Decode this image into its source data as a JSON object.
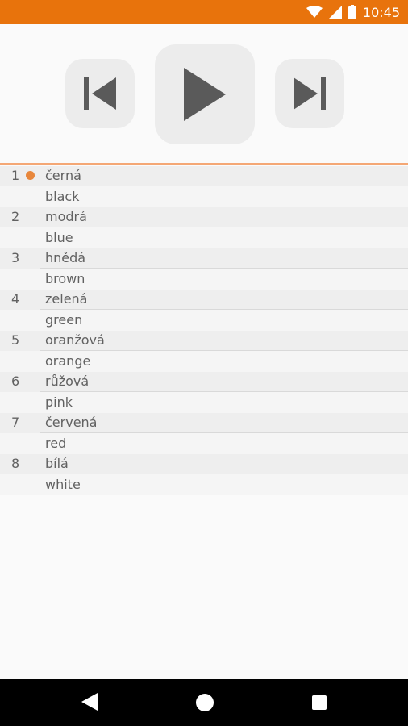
{
  "status_bar": {
    "time": "10:45",
    "icons": [
      "wifi-icon",
      "signal-icon",
      "battery-icon"
    ],
    "color": "#e8730c"
  },
  "player": {
    "controls": [
      "skip-previous-icon",
      "play-icon",
      "skip-next-icon"
    ]
  },
  "accent_color": "#e8873c",
  "playlist": [
    {
      "number": "1",
      "word": "černá",
      "translation": "black",
      "current": true
    },
    {
      "number": "2",
      "word": "modrá",
      "translation": "blue"
    },
    {
      "number": "3",
      "word": "hnědá",
      "translation": "brown"
    },
    {
      "number": "4",
      "word": "zelená",
      "translation": "green"
    },
    {
      "number": "5",
      "word": "oranžová",
      "translation": "orange"
    },
    {
      "number": "6",
      "word": "růžová",
      "translation": "pink"
    },
    {
      "number": "7",
      "word": "červená",
      "translation": "red"
    },
    {
      "number": "8",
      "word": "bílá",
      "translation": "white"
    }
  ],
  "nav_bar": {
    "buttons": [
      "back-icon",
      "home-icon",
      "recents-icon"
    ]
  }
}
